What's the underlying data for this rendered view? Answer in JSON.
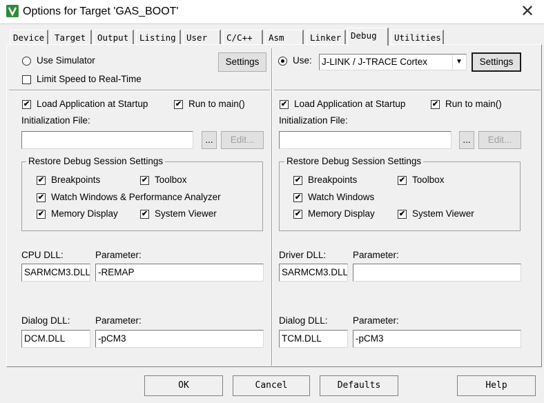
{
  "window": {
    "title": "Options for Target 'GAS_BOOT'",
    "close_glyph": "✕"
  },
  "tabs": [
    {
      "label": "Device"
    },
    {
      "label": "Target"
    },
    {
      "label": "Output"
    },
    {
      "label": "Listing"
    },
    {
      "label": "User"
    },
    {
      "label": "C/C++"
    },
    {
      "label": "Asm"
    },
    {
      "label": "Linker"
    },
    {
      "label": "Debug",
      "active": true
    },
    {
      "label": "Utilities"
    }
  ],
  "left": {
    "use_simulator": "Use Simulator",
    "use_simulator_selected": false,
    "settings_label": "Settings",
    "limit_speed": "Limit Speed to Real-Time",
    "limit_speed_checked": false,
    "load_app": "Load Application at Startup",
    "load_app_checked": true,
    "run_to_main": "Run to main()",
    "run_to_main_checked": true,
    "init_file_label": "Initialization File:",
    "init_file_value": "",
    "browse_label": "...",
    "edit_label": "Edit...",
    "restore_group": "Restore Debug Session Settings",
    "breakpoints": "Breakpoints",
    "toolbox": "Toolbox",
    "watch_windows": "Watch Windows & Performance Analyzer",
    "memory_display": "Memory Display",
    "system_viewer": "System Viewer",
    "cpu_dll_label": "CPU DLL:",
    "cpu_dll_value": "SARMCM3.DLL",
    "cpu_param_label": "Parameter:",
    "cpu_param_value": "-REMAP",
    "dialog_dll_label": "Dialog DLL:",
    "dialog_dll_value": "DCM.DLL",
    "dialog_param_label": "Parameter:",
    "dialog_param_value": "-pCM3"
  },
  "right": {
    "use_label": "Use:",
    "use_selected": true,
    "driver_select": "J-LINK / J-TRACE Cortex",
    "settings_label": "Settings",
    "load_app": "Load Application at Startup",
    "load_app_checked": true,
    "run_to_main": "Run to main()",
    "run_to_main_checked": true,
    "init_file_label": "Initialization File:",
    "init_file_value": "",
    "browse_label": "...",
    "edit_label": "Edit...",
    "restore_group": "Restore Debug Session Settings",
    "breakpoints": "Breakpoints",
    "toolbox": "Toolbox",
    "watch_windows": "Watch Windows",
    "memory_display": "Memory Display",
    "system_viewer": "System Viewer",
    "driver_dll_label": "Driver DLL:",
    "driver_dll_value": "SARMCM3.DLL",
    "driver_param_label": "Parameter:",
    "driver_param_value": "",
    "dialog_dll_label": "Dialog DLL:",
    "dialog_dll_value": "TCM.DLL",
    "dialog_param_label": "Parameter:",
    "dialog_param_value": "-pCM3"
  },
  "footer": {
    "ok": "OK",
    "cancel": "Cancel",
    "defaults": "Defaults",
    "help": "Help"
  },
  "check_glyph": "✔"
}
